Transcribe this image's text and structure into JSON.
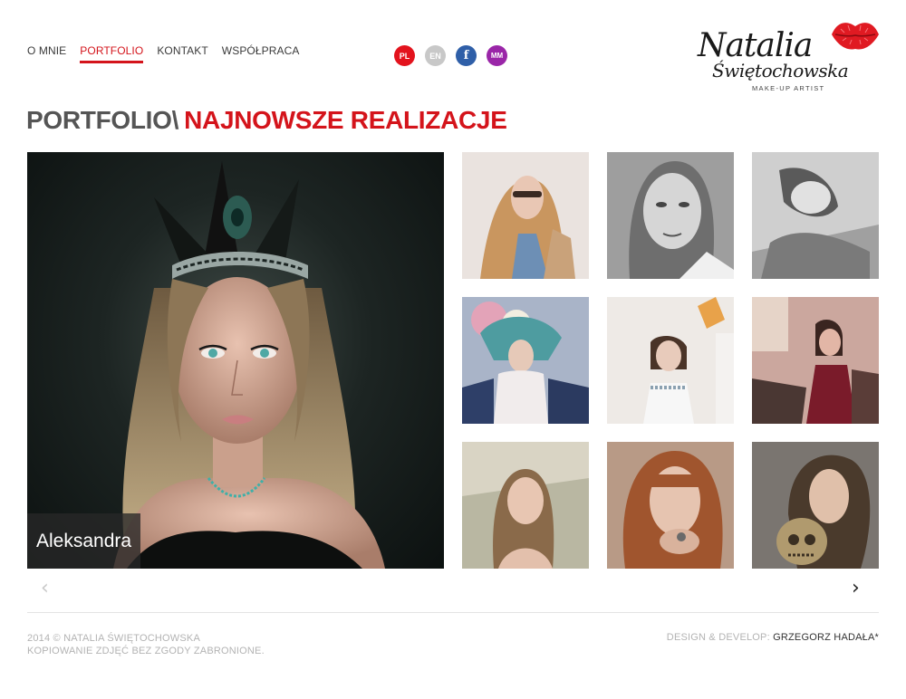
{
  "nav": {
    "items": [
      {
        "label": "O MNIE"
      },
      {
        "label": "PORTFOLIO"
      },
      {
        "label": "KONTAKT"
      },
      {
        "label": "WSPÓŁPRACA"
      }
    ],
    "active": "PORTFOLIO"
  },
  "lang": {
    "pl": "PL",
    "en": "EN",
    "facebook": "f",
    "maxmodels": "MM"
  },
  "logo": {
    "line1": "Natalia",
    "line2": "Świętochowska",
    "tagline": "MAKE-UP ARTIST",
    "icon": "lips-icon"
  },
  "heading": {
    "prefix": "PORTFOLIO\\",
    "title": "NAJNOWSZE REALIZACJE"
  },
  "featured": {
    "caption": "Aleksandra"
  },
  "carousel": {
    "prev": "‹",
    "next": "›"
  },
  "footer": {
    "copyright_line1": "2014 © NATALIA ŚWIĘTOCHOWSKA",
    "copyright_line2": "KOPIOWANIE ZDJĘĆ BEZ ZGODY ZABRONIONE.",
    "design_label": "DESIGN & DEVELOP:",
    "design_credit": "GRZEGORZ HADAŁA*"
  },
  "colors": {
    "accent": "#d4141b",
    "text": "#3a3a3a",
    "muted": "#b3b3b3",
    "facebook": "#2f5fa8",
    "maxmodels": "#9a26a8"
  }
}
